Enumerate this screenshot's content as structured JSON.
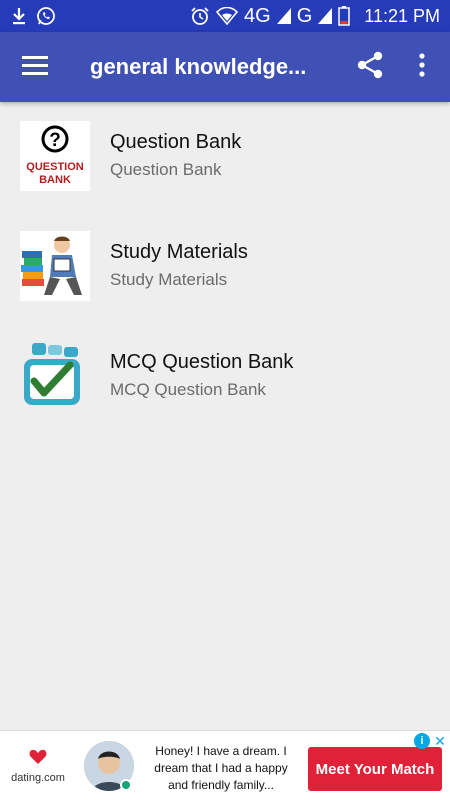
{
  "status_bar": {
    "time": "11:21 PM",
    "network": "4G",
    "network2": "G",
    "icons": [
      "download-icon",
      "whatsapp-icon",
      "alarm-icon",
      "wifi-icon",
      "signal-icon",
      "battery-icon"
    ]
  },
  "app_bar": {
    "title": "general knowledge...",
    "icons": [
      "menu-icon",
      "share-icon",
      "more-vert-icon"
    ],
    "color": "#3f51b5"
  },
  "list": {
    "items": [
      {
        "title": "Question Bank",
        "subtitle": "Question Bank",
        "thumb_top": "?",
        "thumb_caption_line1": "QUESTION",
        "thumb_caption_line2": "BANK"
      },
      {
        "title": "Study Materials",
        "subtitle": "Study Materials"
      },
      {
        "title": "MCQ Question Bank",
        "subtitle": "MCQ Question Bank"
      }
    ]
  },
  "ad": {
    "brand": "dating.com",
    "text": "Honey! I have a dream. I dream that I had a happy and friendly family...",
    "cta": "Meet Your Match",
    "info": "i",
    "close": "✕",
    "cta_color": "#e02238"
  }
}
